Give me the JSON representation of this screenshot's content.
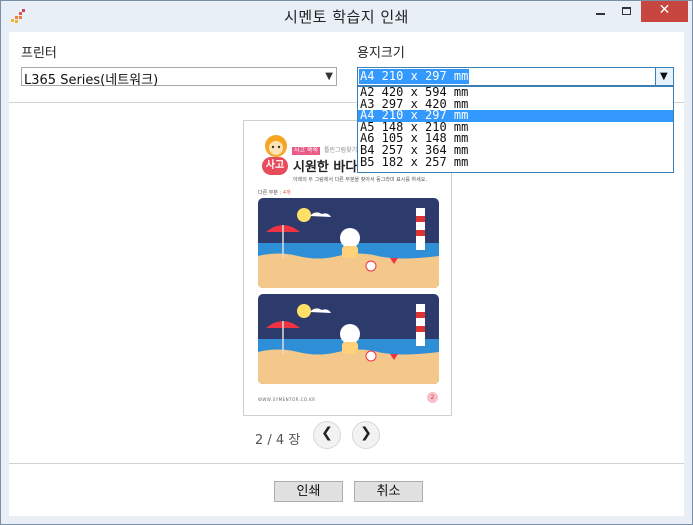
{
  "window": {
    "title": "시멘토 학습지 인쇄"
  },
  "printer": {
    "label": "프린터",
    "selected": "L365 Series(네트워크)"
  },
  "paper": {
    "label": "용지크기",
    "selected": "A4 210 x 297 mm",
    "options": [
      "A2 420 x 594 mm",
      "A3 297 x 420 mm",
      "A4 210 x 297 mm",
      "A5 148 x 210 mm",
      "A6 105 x 148 mm",
      "B4 257 x 364 mm",
      "B5 182 x 257 mm"
    ]
  },
  "preview": {
    "badge": "사고",
    "tag": "사고 쑥쑥",
    "tag2": "틀린그림찾기",
    "title": "시원한 바다",
    "subtitle": "아래의 두 그림에서 다른 부분을 찾아서 동그라미 표시를 하세요.",
    "answer_label": "다른 부분 : ",
    "answer_value": "4개",
    "footer": "WWW.SYMENTOR.CO.KR",
    "page_number": "2"
  },
  "pager": {
    "indicator": "2 / 4 장"
  },
  "buttons": {
    "print": "인쇄",
    "cancel": "취소"
  },
  "colors": {
    "accent": "#3399ff",
    "close": "#c7463f",
    "sky": "#2c3b6b",
    "sea": "#2f8fd6",
    "sand": "#f4c78a"
  }
}
